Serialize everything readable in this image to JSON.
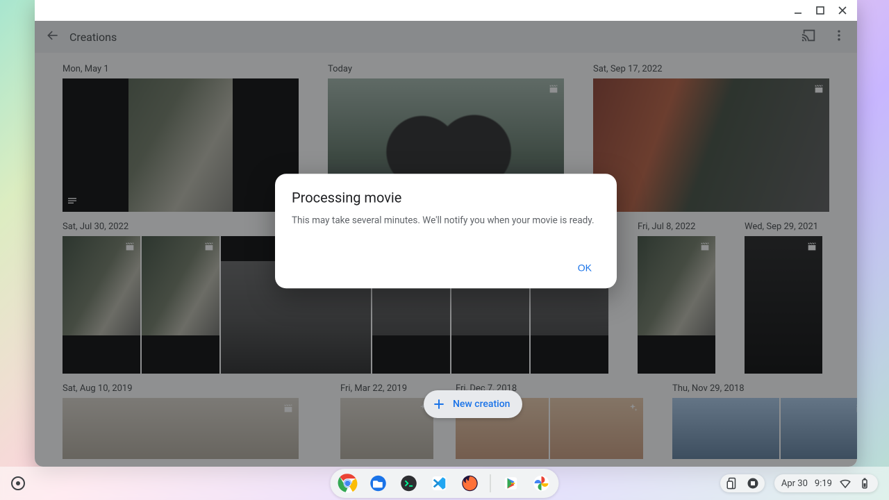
{
  "window_controls": {
    "minimize": "—",
    "maximize": "▢",
    "close": "✕"
  },
  "header": {
    "title": "Creations",
    "cast_icon": "cast-icon",
    "more_icon": "more-vert-icon"
  },
  "rows": [
    {
      "groups": [
        {
          "label": "Mon, May 1",
          "thumbs": [
            {
              "badge": "movie",
              "extra": "notes"
            }
          ]
        },
        {
          "label": "Today",
          "thumbs": [
            {
              "badge": "movie"
            }
          ]
        },
        {
          "label": "Sat, Sep 17, 2022",
          "thumbs": [
            {
              "badge": "movie"
            }
          ]
        }
      ]
    },
    {
      "groups": [
        {
          "label": "Sat, Jul 30, 2022",
          "thumbs": [
            {
              "badge": "movie"
            },
            {
              "badge": "movie"
            },
            {
              "badge": "movie"
            },
            {
              "badge": "movie"
            },
            {
              "badge": "movie"
            },
            {
              "badge": "movie"
            }
          ]
        },
        {
          "label": "Fri, Jul 8, 2022",
          "thumbs": [
            {
              "badge": "movie"
            }
          ]
        },
        {
          "label": "Wed, Sep 29, 2021",
          "thumbs": [
            {
              "badge": "movie"
            }
          ]
        }
      ]
    },
    {
      "groups": [
        {
          "label": "Sat, Aug 10, 2019",
          "thumbs": [
            {
              "badge": "movie"
            }
          ]
        },
        {
          "label": "Fri, Mar 22, 2019",
          "thumbs": [
            {
              "badge": "sparkle"
            }
          ]
        },
        {
          "label": "Fri, Dec 7, 2018",
          "thumbs": [
            {
              "badge": "sparkle"
            },
            {
              "badge": "sparkle"
            }
          ]
        },
        {
          "label": "Thu, Nov 29, 2018",
          "thumbs": [
            {
              "badge": "movie"
            }
          ]
        }
      ]
    }
  ],
  "fab": {
    "label": "New creation",
    "icon": "plus-icon"
  },
  "dialog": {
    "title": "Processing movie",
    "body": "This may take several minutes. We'll notify you when your movie is ready.",
    "ok": "OK"
  },
  "shelf": {
    "apps": [
      "chrome",
      "files",
      "terminal",
      "vscode",
      "firefox",
      "play-store",
      "photos"
    ],
    "tray_icons": [
      "phone-hub",
      "stop"
    ],
    "date": "Apr 30",
    "time": "9:19",
    "status_icons": [
      "wifi",
      "battery"
    ]
  }
}
